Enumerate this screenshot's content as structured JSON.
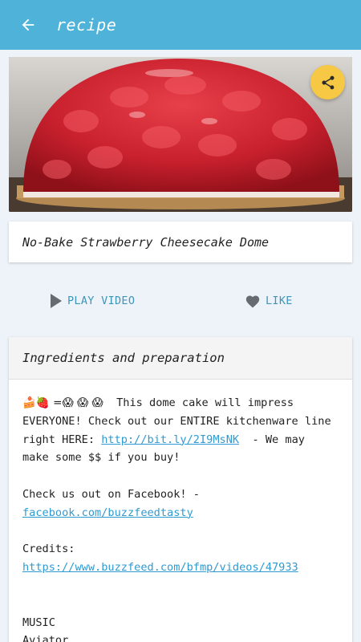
{
  "appbar": {
    "title": "recipe"
  },
  "recipe": {
    "title": "No-Bake Strawberry Cheesecake Dome"
  },
  "actions": {
    "play_label": "PLAY VIDEO",
    "like_label": "LIKE"
  },
  "ingredients": {
    "header": "Ingredients and preparation",
    "emoji": "🍰🍓 =😱 😱 😱",
    "line1_text": "  This dome cake will impress",
    "line2": "EVERYONE! Check out our ENTIRE kitchenware line",
    "line3_prefix": "right HERE: ",
    "shop_link": "http://bit.ly/2I9MsNK",
    "line3_suffix": "  - We may",
    "line4": "make some $$ if you buy!",
    "facebook_text": "Check us out on Facebook! -",
    "facebook_link": "facebook.com/buzzfeedtasty",
    "credits_label": "Credits:",
    "credits_link": "https://www.buzzfeed.com/bfmp/videos/47933",
    "music_label": "MUSIC",
    "music_track": "Aviator"
  },
  "colors": {
    "appbar": "#4fb3d9",
    "accent": "#3d96b8",
    "fab": "#f6c844",
    "link": "#2f9bd0"
  },
  "icons": {
    "back": "arrow-left-icon",
    "share": "share-icon",
    "play": "play-icon",
    "like": "heart-icon"
  }
}
